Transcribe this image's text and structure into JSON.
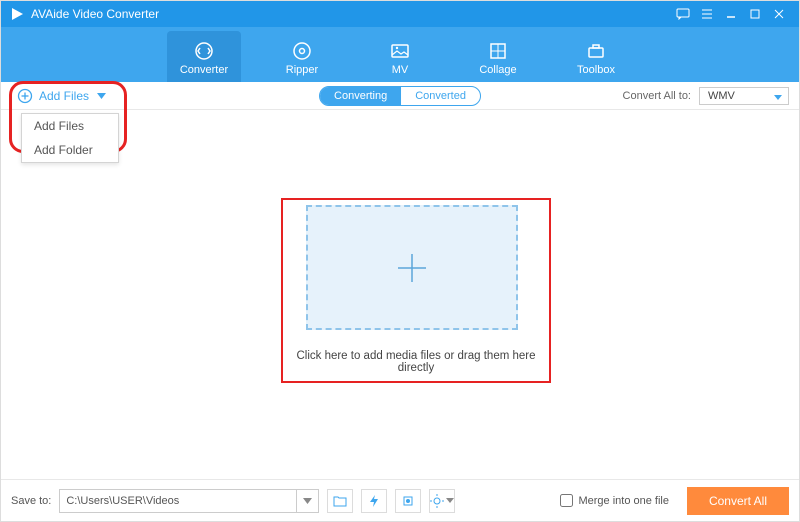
{
  "app": {
    "title": "AVAide Video Converter"
  },
  "tabs": {
    "converter": "Converter",
    "ripper": "Ripper",
    "mv": "MV",
    "collage": "Collage",
    "toolbox": "Toolbox"
  },
  "subbar": {
    "add_files": "Add Files",
    "converting": "Converting",
    "converted": "Converted",
    "convert_all_label": "Convert All to:",
    "format_selected": "WMV"
  },
  "add_menu": {
    "add_files": "Add Files",
    "add_folder": "Add Folder"
  },
  "dropzone": {
    "hint": "Click here to add media files or drag them here directly"
  },
  "bottom": {
    "save_to_label": "Save to:",
    "save_path": "C:\\Users\\USER\\Videos",
    "merge_label": "Merge into one file",
    "convert_all_btn": "Convert All"
  }
}
